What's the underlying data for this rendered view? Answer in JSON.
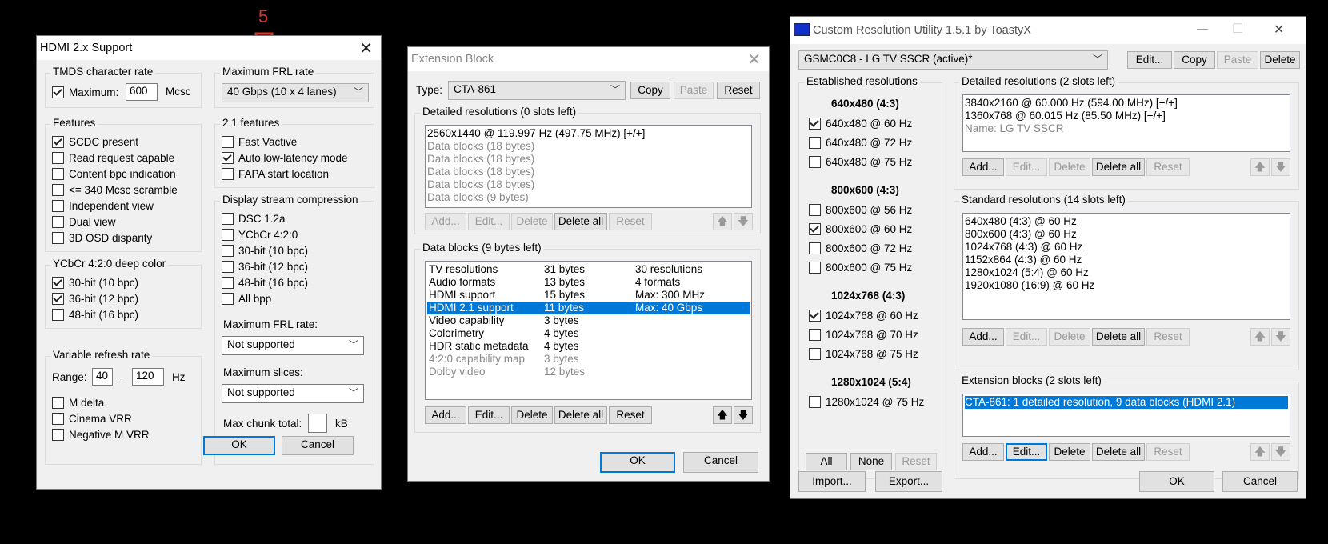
{
  "annotation": {
    "number": "5"
  },
  "hdmi": {
    "title": "HDMI 2.x Support",
    "tmds_label": "TMDS character rate",
    "maximum_label": "Maximum:",
    "maximum_value": "600",
    "mcsc": "Mcsc",
    "frl_group": "Maximum FRL rate",
    "frl_value": "40 Gbps (10 x 4 lanes)",
    "features_label": "Features",
    "features": [
      {
        "label": "SCDC present",
        "checked": true
      },
      {
        "label": "Read request capable",
        "checked": false
      },
      {
        "label": "Content bpc indication",
        "checked": false
      },
      {
        "label": "<= 340 Mcsc scramble",
        "checked": false
      },
      {
        "label": "Independent view",
        "checked": false
      },
      {
        "label": "Dual view",
        "checked": false
      },
      {
        "label": "3D OSD disparity",
        "checked": false
      }
    ],
    "f21_label": "2.1 features",
    "f21": [
      {
        "label": "Fast Vactive",
        "checked": false
      },
      {
        "label": "Auto low-latency mode",
        "checked": true
      },
      {
        "label": "FAPA start location",
        "checked": false
      }
    ],
    "ycbcr_label": "YCbCr 4:2:0 deep color",
    "ycbcr": [
      {
        "label": "30-bit (10 bpc)",
        "checked": true
      },
      {
        "label": "36-bit (12 bpc)",
        "checked": true
      },
      {
        "label": "48-bit (16 bpc)",
        "checked": false
      }
    ],
    "dsc_label": "Display stream compression",
    "dsc": [
      {
        "label": "DSC 1.2a",
        "checked": false
      },
      {
        "label": "YCbCr 4:2:0",
        "checked": false
      },
      {
        "label": "30-bit (10 bpc)",
        "checked": false
      },
      {
        "label": "36-bit (12 bpc)",
        "checked": false
      },
      {
        "label": "48-bit (16 bpc)",
        "checked": false
      },
      {
        "label": "All bpp",
        "checked": false
      }
    ],
    "dsc_frl_label": "Maximum FRL rate:",
    "dsc_frl_value": "Not supported",
    "slices_label": "Maximum slices:",
    "slices_value": "Not supported",
    "chunk_label": "Max chunk total:",
    "chunk_unit": "kB",
    "vrr_label": "Variable refresh rate",
    "range_label": "Range:",
    "range_min": "40",
    "range_dash": "–",
    "range_max": "120",
    "hz": "Hz",
    "vrr": [
      {
        "label": "M delta",
        "checked": false
      },
      {
        "label": "Cinema VRR",
        "checked": false
      },
      {
        "label": "Negative M VRR",
        "checked": false
      }
    ],
    "ok": "OK",
    "cancel": "Cancel"
  },
  "ext": {
    "title": "Extension Block",
    "type_label": "Type:",
    "type_value": "CTA-861",
    "copy": "Copy",
    "paste": "Paste",
    "reset": "Reset",
    "detailed_label": "Detailed resolutions (0 slots left)",
    "detailed": [
      {
        "text": "2560x1440 @ 119.997 Hz (497.75 MHz) [+/+]",
        "grey": false
      },
      {
        "text": "Data blocks (18 bytes)",
        "grey": true
      },
      {
        "text": "Data blocks (18 bytes)",
        "grey": true
      },
      {
        "text": "Data blocks (18 bytes)",
        "grey": true
      },
      {
        "text": "Data blocks (18 bytes)",
        "grey": true
      },
      {
        "text": "Data blocks (9 bytes)",
        "grey": true
      }
    ],
    "add": "Add...",
    "edit": "Edit...",
    "delete": "Delete",
    "delete_all": "Delete all",
    "up": "🡅",
    "down": "🡇",
    "datablocks_label": "Data blocks (9 bytes left)",
    "datablocks": [
      {
        "name": "TV resolutions",
        "size": "31 bytes",
        "info": "30 resolutions",
        "grey": false,
        "sel": false
      },
      {
        "name": "Audio formats",
        "size": "13 bytes",
        "info": "4 formats",
        "grey": false,
        "sel": false
      },
      {
        "name": "HDMI support",
        "size": "15 bytes",
        "info": "Max: 300 MHz",
        "grey": false,
        "sel": false
      },
      {
        "name": "HDMI 2.1 support",
        "size": "11 bytes",
        "info": "Max: 40 Gbps",
        "grey": false,
        "sel": true
      },
      {
        "name": "Video capability",
        "size": "3 bytes",
        "info": "",
        "grey": false,
        "sel": false
      },
      {
        "name": "Colorimetry",
        "size": "4 bytes",
        "info": "",
        "grey": false,
        "sel": false
      },
      {
        "name": "HDR static metadata",
        "size": "4 bytes",
        "info": "",
        "grey": false,
        "sel": false
      },
      {
        "name": "4:2:0 capability map",
        "size": "3 bytes",
        "info": "",
        "grey": true,
        "sel": false
      },
      {
        "name": "Dolby video",
        "size": "12 bytes",
        "info": "",
        "grey": true,
        "sel": false
      }
    ],
    "ok": "OK",
    "cancel": "Cancel"
  },
  "cru": {
    "title": "Custom Resolution Utility 1.5.1 by ToastyX",
    "minimize": "—",
    "maximize": "☐",
    "close": "✕",
    "monitor": "GSMC0C8 - LG TV SSCR (active)*",
    "edit": "Edit...",
    "copy": "Copy",
    "paste": "Paste",
    "delete": "Delete",
    "established_label": "Established resolutions",
    "est_groups": [
      {
        "heading": "640x480 (4:3)",
        "items": [
          {
            "label": "640x480 @ 60 Hz",
            "checked": true
          },
          {
            "label": "640x480 @ 72 Hz",
            "checked": false
          },
          {
            "label": "640x480 @ 75 Hz",
            "checked": false
          }
        ]
      },
      {
        "heading": "800x600 (4:3)",
        "items": [
          {
            "label": "800x600 @ 56 Hz",
            "checked": false
          },
          {
            "label": "800x600 @ 60 Hz",
            "checked": true
          },
          {
            "label": "800x600 @ 72 Hz",
            "checked": false
          },
          {
            "label": "800x600 @ 75 Hz",
            "checked": false
          }
        ]
      },
      {
        "heading": "1024x768 (4:3)",
        "items": [
          {
            "label": "1024x768 @ 60 Hz",
            "checked": true
          },
          {
            "label": "1024x768 @ 70 Hz",
            "checked": false
          },
          {
            "label": "1024x768 @ 75 Hz",
            "checked": false
          }
        ]
      },
      {
        "heading": "1280x1024 (5:4)",
        "items": [
          {
            "label": "1280x1024 @ 75 Hz",
            "checked": false
          }
        ]
      }
    ],
    "all": "All",
    "none": "None",
    "reset": "Reset",
    "detailed_label": "Detailed resolutions (2 slots left)",
    "detailed": [
      {
        "text": "3840x2160 @ 60.000 Hz (594.00 MHz) [+/+]",
        "grey": false
      },
      {
        "text": "1360x768 @ 60.015 Hz (85.50 MHz) [+/+]",
        "grey": false
      },
      {
        "text": "Name: LG TV SSCR",
        "grey": true
      }
    ],
    "add": "Add...",
    "delete_all": "Delete all",
    "up": "🡅",
    "down": "🡇",
    "standard_label": "Standard resolutions (14 slots left)",
    "standard": [
      "640x480 (4:3) @ 60 Hz",
      "800x600 (4:3) @ 60 Hz",
      "1024x768 (4:3) @ 60 Hz",
      "1152x864 (4:3) @ 60 Hz",
      "1280x1024 (5:4) @ 60 Hz",
      "1920x1080 (16:9) @ 60 Hz"
    ],
    "ext_label": "Extension blocks (2 slots left)",
    "ext_item": "CTA-861: 1 detailed resolution, 9 data blocks (HDMI 2.1)",
    "import": "Import...",
    "export": "Export...",
    "ok": "OK",
    "cancel": "Cancel",
    "accent": "#0078d7"
  }
}
